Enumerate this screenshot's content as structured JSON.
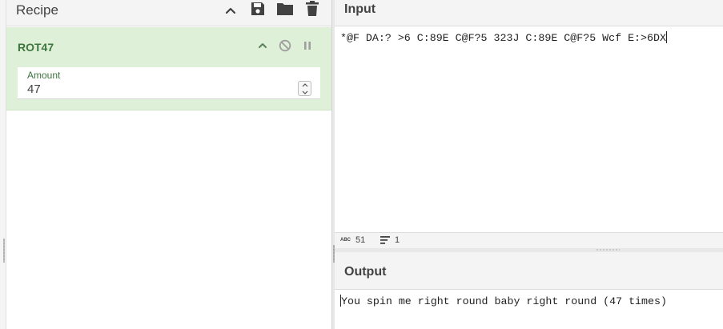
{
  "recipe": {
    "title": "Recipe",
    "icons": [
      "chevron-up-icon",
      "save-icon",
      "folder-icon",
      "trash-icon"
    ]
  },
  "operation": {
    "name": "ROT47",
    "argument": {
      "label": "Amount",
      "value": "47"
    }
  },
  "input": {
    "title": "Input",
    "text": "*@F DA:? >6 C:89E C@F?5 323J C:89E C@F?5 Wcf E:>6DX",
    "status": {
      "char_count": "51",
      "line_count": "1"
    }
  },
  "output": {
    "title": "Output",
    "text": "You spin me right round baby right round (47 times)"
  },
  "colors": {
    "op_background": "#dff0d8",
    "op_text": "#3c763d",
    "header_background": "#f4f4f4"
  }
}
